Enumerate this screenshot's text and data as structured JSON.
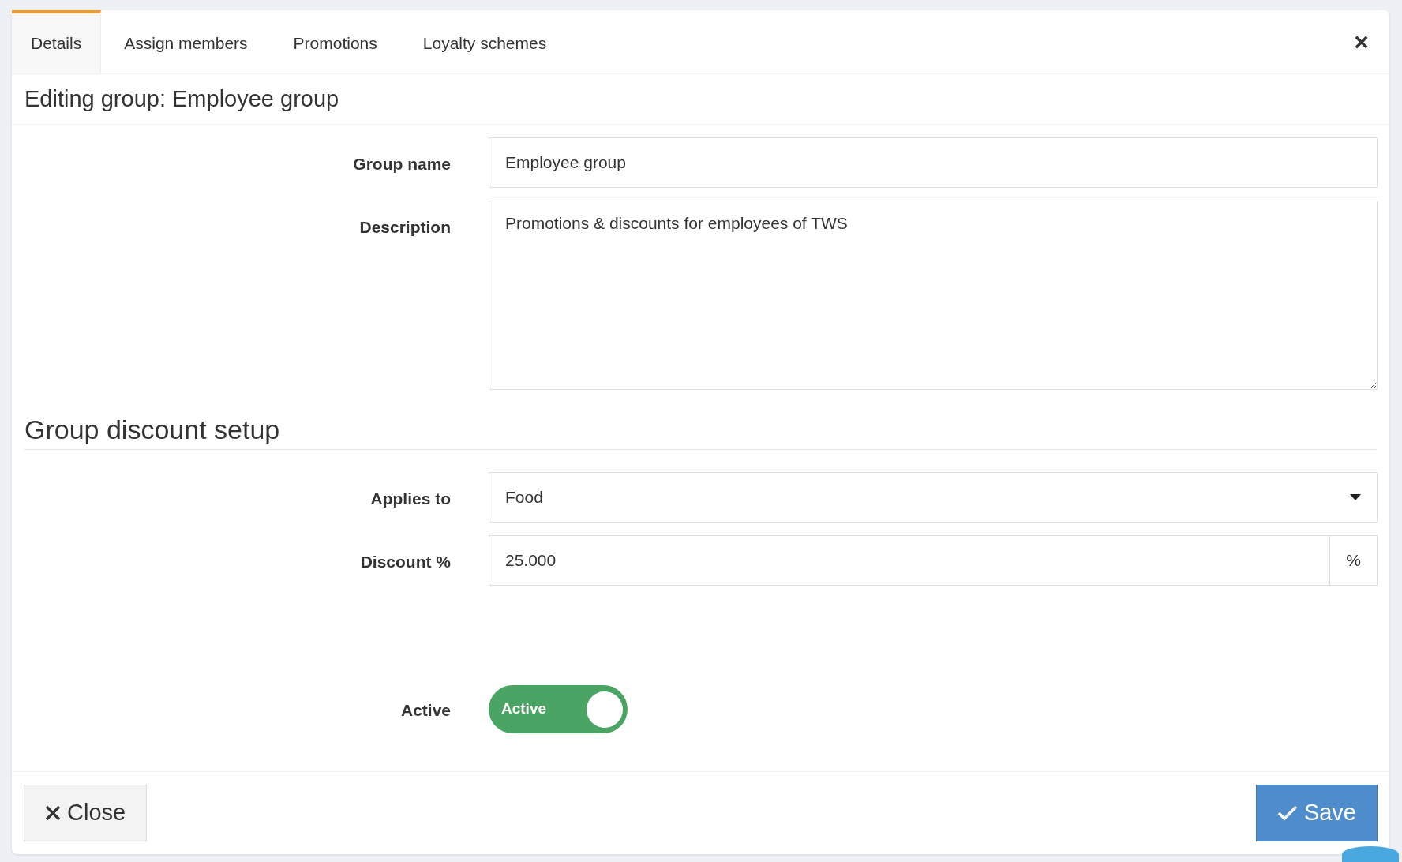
{
  "tabs": [
    {
      "label": "Details",
      "selected": true
    },
    {
      "label": "Assign members",
      "selected": false
    },
    {
      "label": "Promotions",
      "selected": false
    },
    {
      "label": "Loyalty schemes",
      "selected": false
    }
  ],
  "close_icon": "×",
  "title": "Editing group: Employee group",
  "fields": [
    {
      "kind": "text",
      "label": "Group name",
      "value": "Employee group"
    },
    {
      "kind": "textarea",
      "label": "Description",
      "value": "Promotions & discounts for employees of TWS"
    }
  ],
  "section_title": "Group discount setup",
  "discount_fields": [
    {
      "kind": "select",
      "label": "Applies to",
      "value": "Food"
    },
    {
      "kind": "suffix",
      "label": "Discount %",
      "value": "25.000",
      "suffix": "%"
    },
    {
      "kind": "toggle",
      "label": "Active",
      "text": "Active",
      "on": true
    }
  ],
  "footer": {
    "close_button": "Close",
    "save_button": "Save"
  }
}
